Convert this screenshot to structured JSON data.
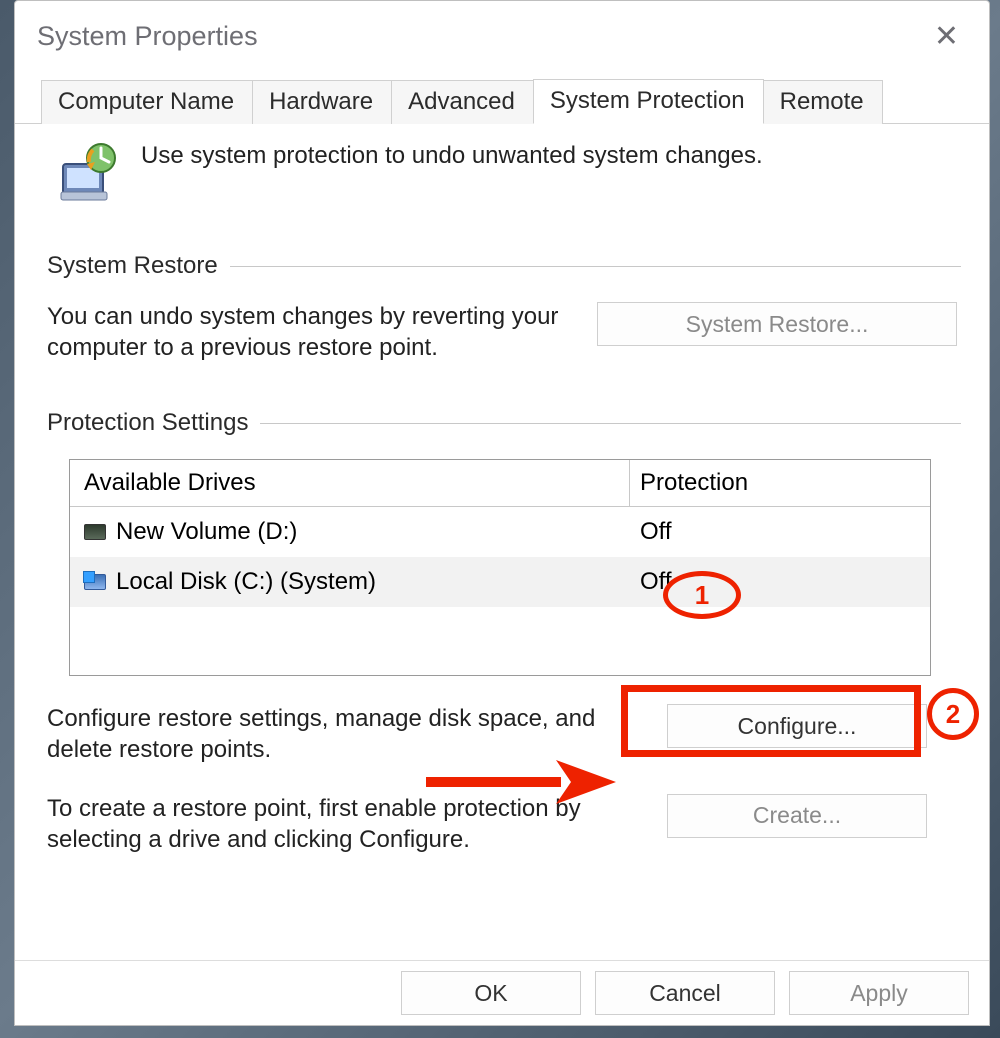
{
  "window": {
    "title": "System Properties"
  },
  "tabs": {
    "computer_name": "Computer Name",
    "hardware": "Hardware",
    "advanced": "Advanced",
    "system_protection": "System Protection",
    "remote": "Remote"
  },
  "intro": "Use system protection to undo unwanted system changes.",
  "sections": {
    "restore": {
      "title": "System Restore",
      "desc": "You can undo system changes by reverting your computer to a previous restore point.",
      "button": "System Restore..."
    },
    "protection": {
      "title": "Protection Settings",
      "headers": {
        "drives": "Available Drives",
        "protection": "Protection"
      },
      "rows": [
        {
          "name": "New Volume (D:)",
          "status": "Off",
          "icon": "vol"
        },
        {
          "name": "Local Disk (C:) (System)",
          "status": "Off",
          "icon": "sys",
          "selected": true
        }
      ],
      "configure_desc": "Configure restore settings, manage disk space, and delete restore points.",
      "configure_button": "Configure...",
      "create_desc": "To create a restore point, first enable protection by selecting a drive and clicking Configure.",
      "create_button": "Create..."
    }
  },
  "footer": {
    "ok": "OK",
    "cancel": "Cancel",
    "apply": "Apply"
  },
  "annotations": {
    "step1": "1",
    "step2": "2"
  }
}
